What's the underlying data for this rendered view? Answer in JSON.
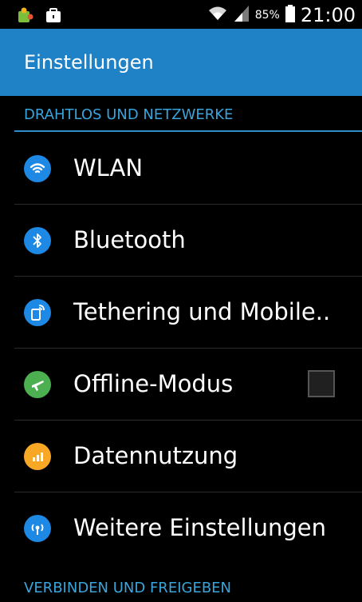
{
  "status_bar": {
    "battery_percent": "85%",
    "time": "21:00"
  },
  "app_bar": {
    "title": "Einstellungen"
  },
  "sections": [
    {
      "title": "DRAHTLOS UND NETZWERKE"
    },
    {
      "title": "VERBINDEN UND FREIGEBEN"
    }
  ],
  "items": [
    {
      "label": "WLAN",
      "icon": "wifi-icon",
      "icon_bg": "#1e88e5"
    },
    {
      "label": "Bluetooth",
      "icon": "bluetooth-icon",
      "icon_bg": "#1e88e5"
    },
    {
      "label": "Tethering und Mobile..",
      "icon": "tethering-icon",
      "icon_bg": "#1e88e5"
    },
    {
      "label": "Offline-Modus",
      "icon": "airplane-icon",
      "icon_bg": "#4caf50",
      "checked": false
    },
    {
      "label": "Datennutzung",
      "icon": "data-usage-icon",
      "icon_bg": "#f9a825"
    },
    {
      "label": "Weitere Einstellungen",
      "icon": "more-networks-icon",
      "icon_bg": "#1e88e5"
    }
  ],
  "colors": {
    "accent": "#1f82c6",
    "section_text": "#39a5dc"
  }
}
